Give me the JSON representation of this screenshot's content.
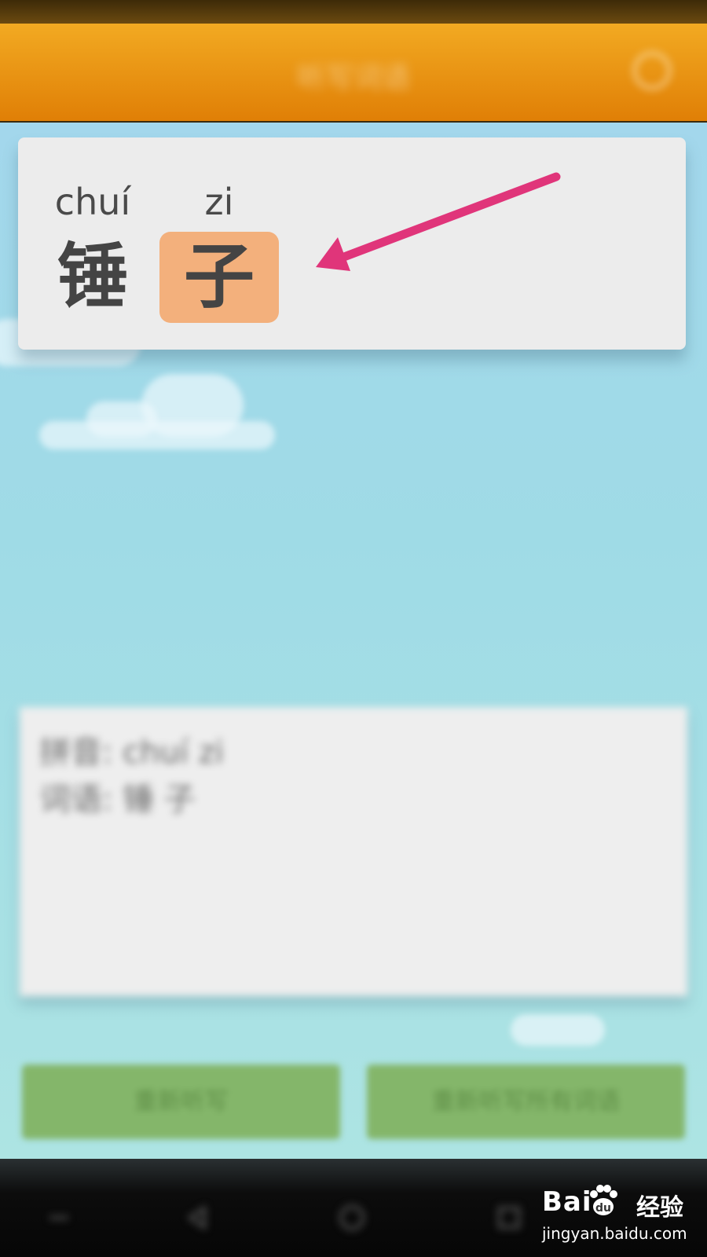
{
  "header": {
    "title": "听写词语"
  },
  "word_card": {
    "characters": [
      {
        "pinyin": "chuí",
        "hanzi": "锤",
        "highlighted": false
      },
      {
        "pinyin": "zi",
        "hanzi": "子",
        "highlighted": true
      }
    ]
  },
  "info_panel": {
    "line1": "拼音: chuí zi",
    "line2": "词语: 锤 子"
  },
  "buttons": {
    "left": "重新听写",
    "right": "重新听写所有词语"
  },
  "watermark": {
    "brand": "Bai",
    "brand_cn": "经验",
    "url": "jingyan.baidu.com"
  },
  "colors": {
    "header": "#e98f0c",
    "highlight": "#f3b07c",
    "arrow": "#e0357a",
    "button": "#84b66a"
  }
}
